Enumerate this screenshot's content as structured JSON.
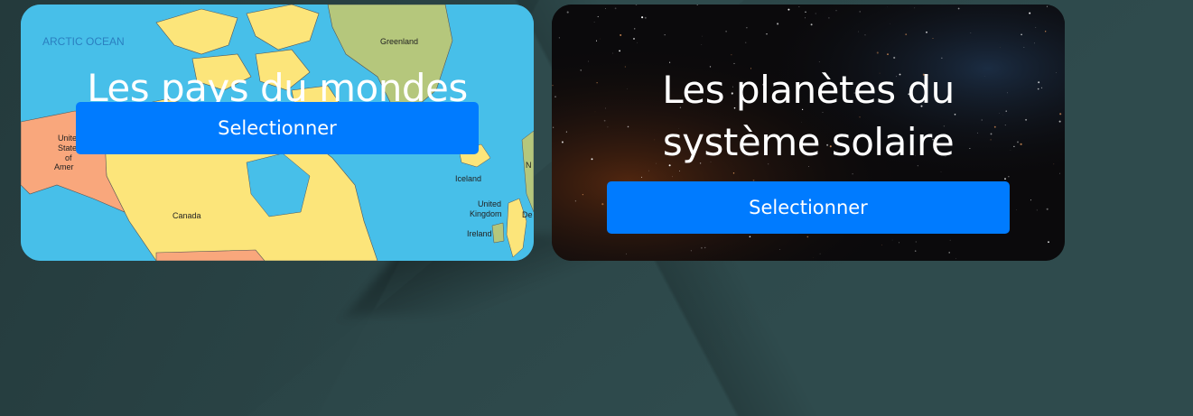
{
  "cards": [
    {
      "title": "Les pays du mondes",
      "button_label": "Selectionner",
      "map_labels": {
        "ocean": "ARCTIC OCEAN",
        "greenland": "Greenland",
        "canada": "Canada",
        "iceland": "Iceland",
        "uk": "United Kingdom",
        "uk_line1": "United",
        "uk_line2": "Kingdom",
        "ireland": "Ireland",
        "usa_line1": "Unite",
        "usa_line2": "State",
        "usa_line3": "of",
        "usa_line4": "Amer",
        "edge_n": "N",
        "edge_de": "De"
      }
    },
    {
      "title": "Les planètes du système solaire",
      "button_label": "Selectionner"
    }
  ],
  "colors": {
    "background": "#2f4b4d",
    "button": "#007bff",
    "ocean": "#47bfe9",
    "land_yellow": "#fce57a",
    "land_green": "#b5c77c",
    "land_orange": "#f9a77c"
  }
}
